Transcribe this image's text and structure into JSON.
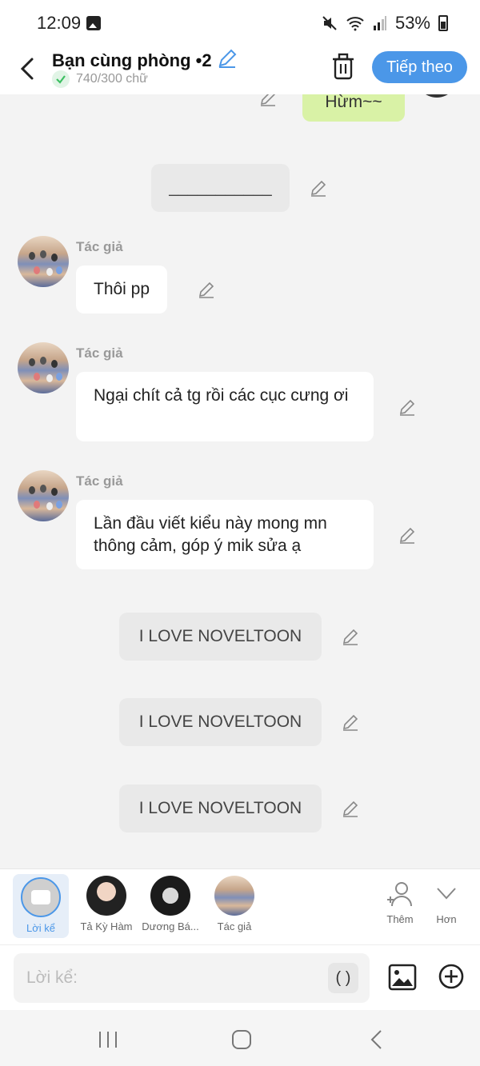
{
  "status_bar": {
    "time": "12:09",
    "battery": "53%",
    "icons": [
      "gallery-icon",
      "mute-icon",
      "wifi-icon",
      "signal-icon",
      "battery-icon"
    ]
  },
  "header": {
    "title": "Bạn cùng phòng •2",
    "word_count": "740/300 chữ",
    "next_label": "Tiếp theo",
    "accent_color": "#4b97e8"
  },
  "chat": {
    "top_bubble": "Hừm~~",
    "divider_bubble": "___________",
    "author_messages": [
      {
        "author": "Tác giả",
        "text": "Thôi pp"
      },
      {
        "author": "Tác giả",
        "text": "Ngại chít cả tg rồi các cục cưng ơi"
      },
      {
        "author": "Tác giả",
        "text": "Lần đầu viết kiểu này mong mn thông cảm, góp ý mik sửa ạ"
      }
    ],
    "narration_bubbles": [
      "I LOVE NOVELTOON",
      "I LOVE NOVELTOON",
      "I LOVE NOVELTOON"
    ]
  },
  "characters": [
    {
      "label": "Lời kể",
      "selected": true
    },
    {
      "label": "Tả Kỳ Hàm"
    },
    {
      "label": "Dương Bá..."
    },
    {
      "label": "Tác giả"
    }
  ],
  "char_actions": {
    "add_label": "Thêm",
    "more_label": "Hơn"
  },
  "input": {
    "placeholder": "Lời kể:",
    "paren_label": "( )"
  }
}
